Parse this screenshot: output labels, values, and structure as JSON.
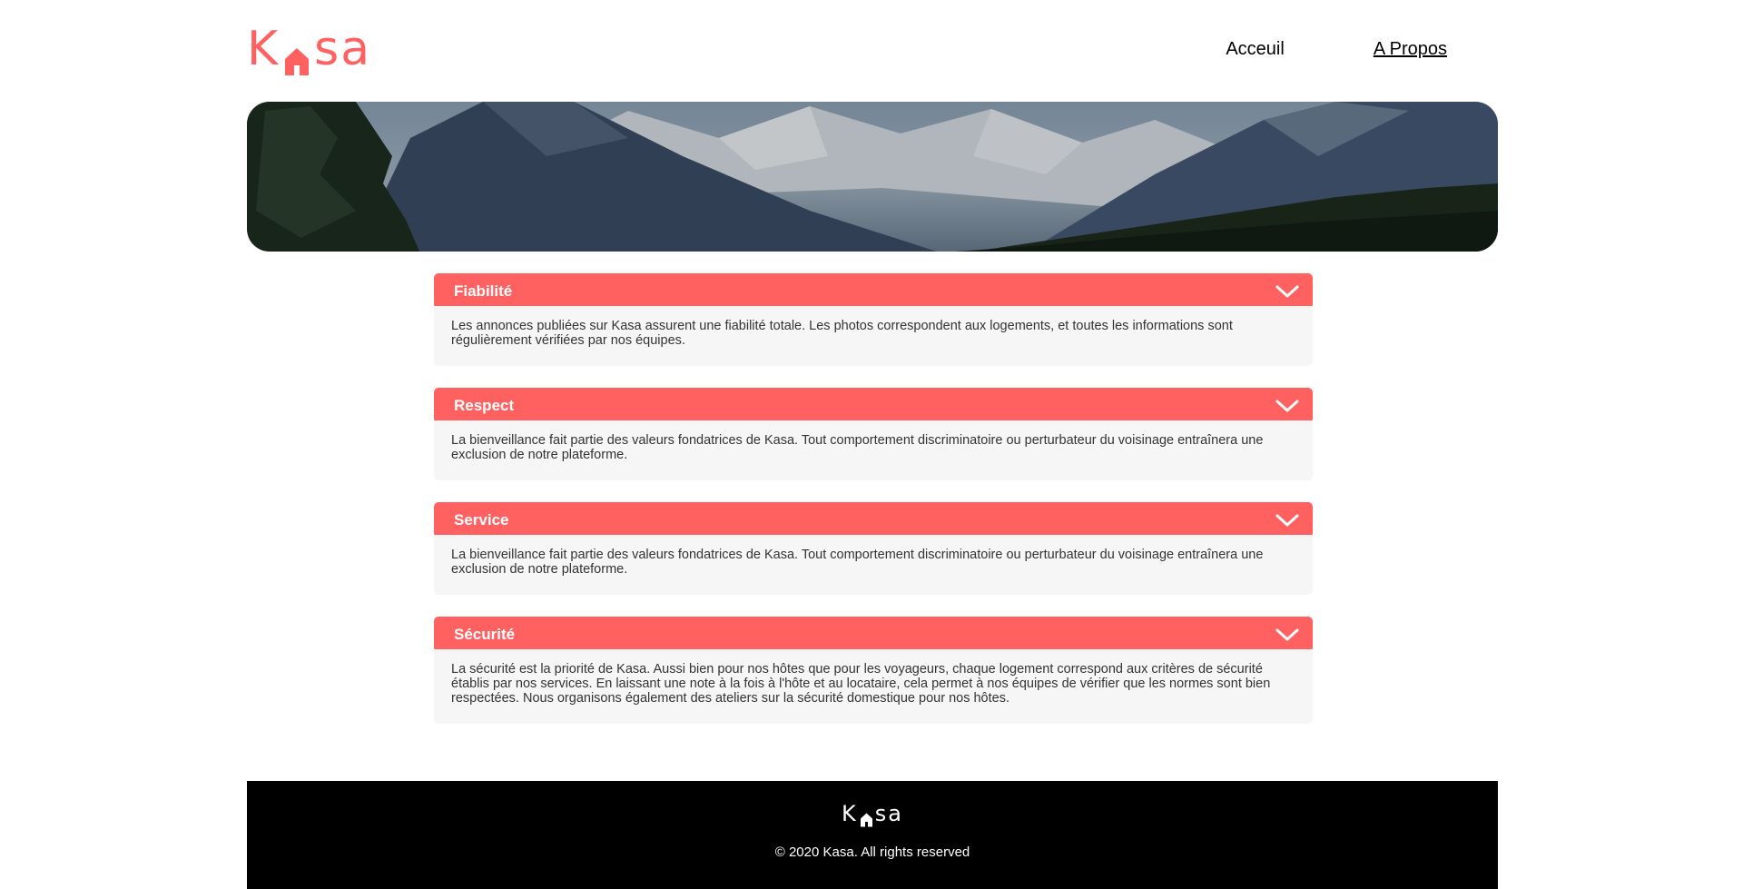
{
  "brand": {
    "logo_prefix": "K",
    "logo_suffix": "sa",
    "accent_color": "#ff6060"
  },
  "nav": {
    "items": [
      {
        "label": "Acceuil",
        "active": false
      },
      {
        "label": "A Propos",
        "active": true
      }
    ]
  },
  "banner": {
    "icon": "mountain-landscape-image"
  },
  "collapses": [
    {
      "title": "Fiabilité",
      "text": "Les annonces publiées sur Kasa assurent une fiabilité totale. Les photos correspondent aux logements, et toutes les informations sont régulièrement vérifiées par nos équipes."
    },
    {
      "title": "Respect",
      "text": "La bienveillance fait partie des valeurs fondatrices de Kasa. Tout comportement discriminatoire ou perturbateur du voisinage entraînera une exclusion de notre plateforme."
    },
    {
      "title": "Service",
      "text": "La bienveillance fait partie des valeurs fondatrices de Kasa. Tout comportement discriminatoire ou perturbateur du voisinage entraînera une exclusion de notre plateforme."
    },
    {
      "title": "Sécurité",
      "text": "La sécurité est la priorité de Kasa. Aussi bien pour nos hôtes que pour les voyageurs, chaque logement correspond aux critères de sécurité établis par nos services. En laissant une note à la fois à l'hôte et au locataire, cela permet à nos équipes de vérifier que les normes sont bien respectées. Nous organisons également des ateliers sur la sécurité domestique pour nos hôtes."
    }
  ],
  "footer": {
    "logo_prefix": "K",
    "logo_suffix": "sa",
    "copyright": "© 2020 Kasa. All rights reserved"
  }
}
